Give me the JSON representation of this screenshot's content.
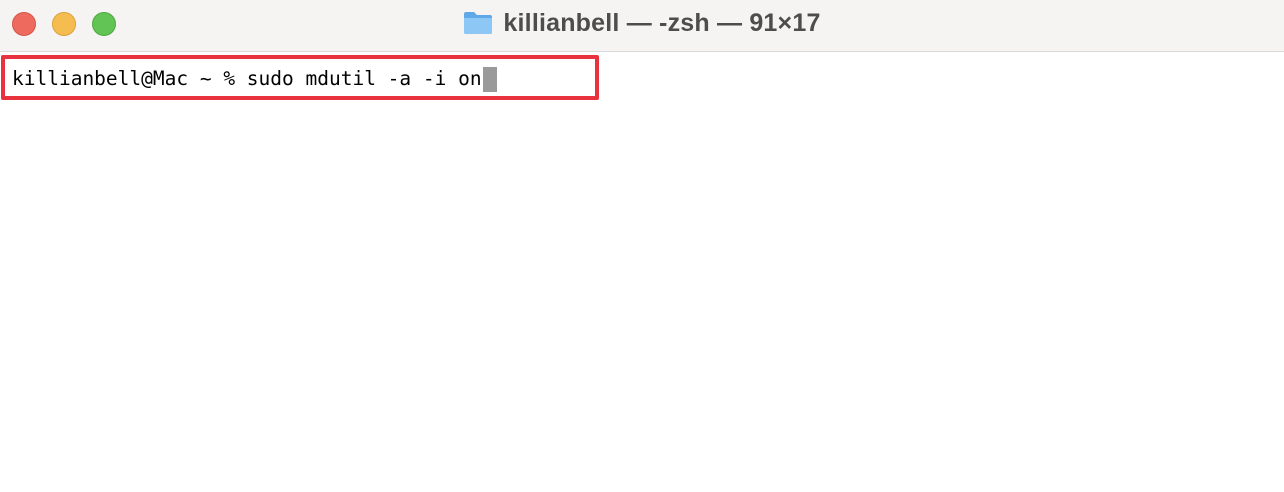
{
  "window": {
    "title": "killianbell — -zsh — 91×17",
    "title_icon": "folder-icon"
  },
  "traffic_lights": {
    "close_color": "#ee6a5f",
    "minimize_color": "#f5bd4f",
    "zoom_color": "#61c454"
  },
  "terminal": {
    "prompt_line": "killianbell@Mac ~ % sudo mdutil -a -i on",
    "cursor": "block",
    "highlight_color": "#e8333f"
  }
}
